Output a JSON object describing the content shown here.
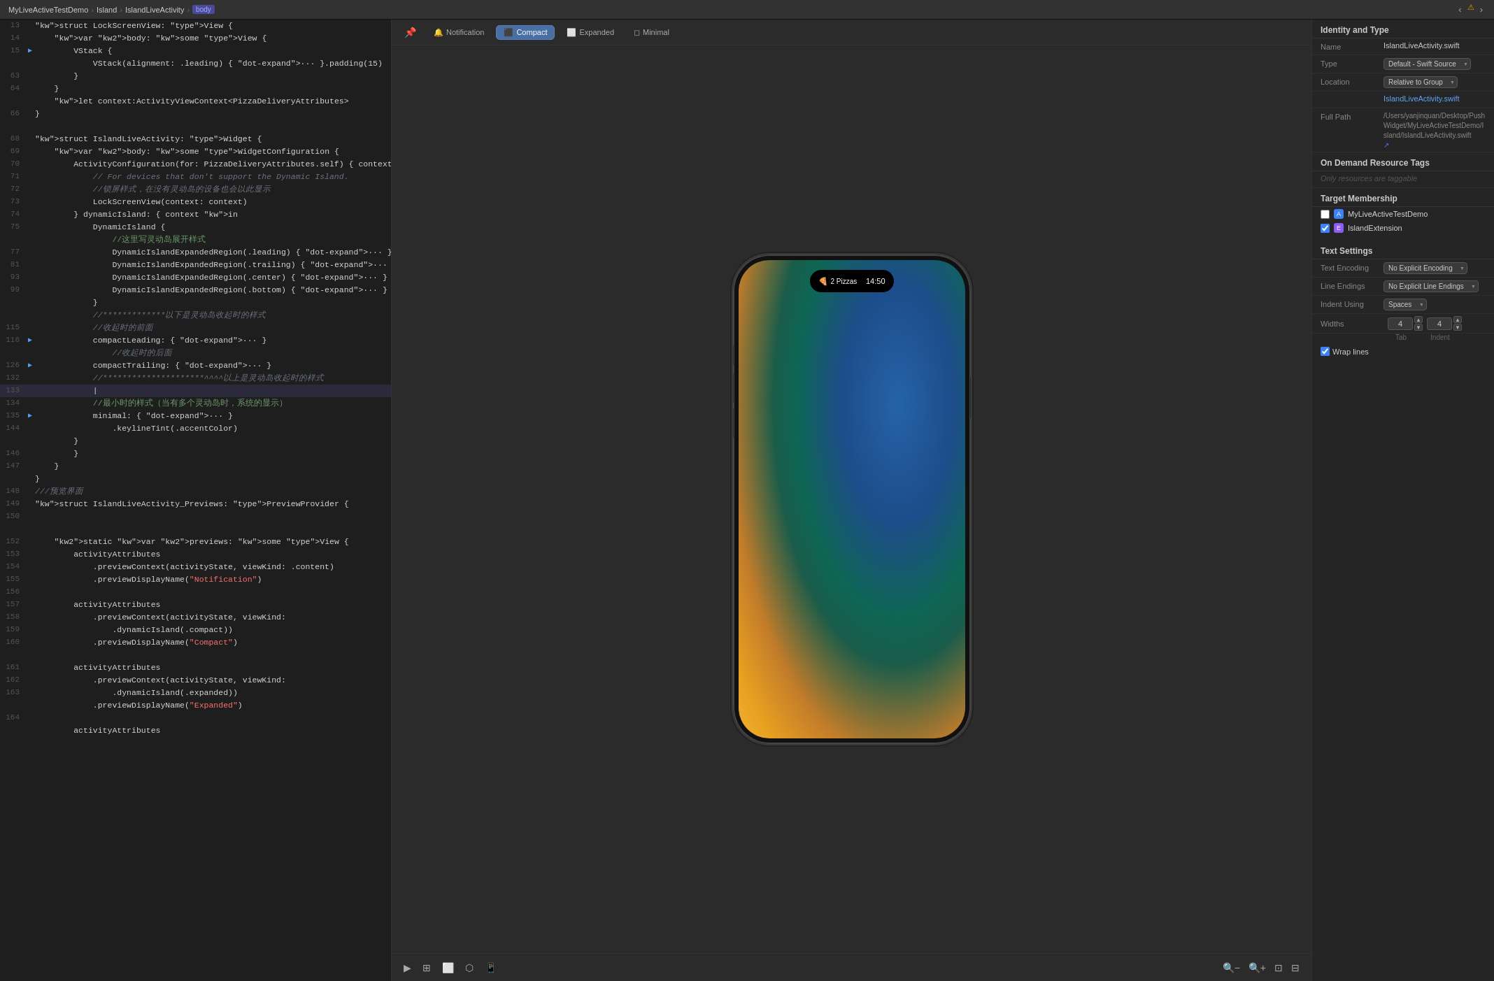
{
  "titlebar": {
    "app": "MyLiveActiveTestDemo",
    "sep1": "›",
    "folder": "Island",
    "sep2": "›",
    "file": "IslandLiveActivity",
    "sep3": "›",
    "body_label": "body",
    "nav_back": "‹",
    "nav_forward": "›",
    "warning": "⚠"
  },
  "preview_toolbar": {
    "pin_icon": "📌",
    "notification_label": "Notification",
    "compact_label": "Compact",
    "expanded_label": "Expanded",
    "minimal_label": "Minimal",
    "active_tab": "Compact"
  },
  "preview_bottom": {
    "play_icon": "▶",
    "grid_icon": "⊞",
    "qr_icon": "⬜",
    "more_icon": "⋯",
    "device_icon": "📱",
    "clock_icon": "⏱",
    "zoom_out_icon": "−",
    "zoom_in_icon": "+",
    "zoom_fit_icon": "⊡",
    "zoom_fill_icon": "⊟"
  },
  "phone": {
    "pizza_icon": "🍕",
    "pizza_label": "2 Pizzas",
    "time": "14:50"
  },
  "inspector": {
    "title": "Identity and Type",
    "name_label": "Name",
    "name_value": "IslandLiveActivity.swift",
    "type_label": "Type",
    "type_value": "Default - Swift Source",
    "location_label": "Location",
    "location_value": "Relative to Group",
    "filename_value": "IslandLiveActivity.swift",
    "full_path_label": "Full Path",
    "full_path_value": "/Users/yanjinquan/Desktop/PushWidget/MyLiveActiveTestDemo/Island/IslandLiveActivity.swift",
    "full_path_icon": "↗",
    "on_demand_label": "On Demand Resource Tags",
    "on_demand_hint": "Only resources are taggable",
    "target_membership_label": "Target Membership",
    "target1": "MyLiveActiveTestDemo",
    "target2": "IslandExtension",
    "text_settings_label": "Text Settings",
    "text_encoding_label": "Text Encoding",
    "text_encoding_value": "No Explicit Encoding",
    "line_endings_label": "Line Endings",
    "line_endings_value": "No Explicit Line Endings",
    "indent_using_label": "Indent Using",
    "indent_using_value": "Spaces",
    "widths_label": "Widths",
    "tab_value": "4",
    "indent_value": "4",
    "tab_sublabel": "Tab",
    "indent_sublabel": "Indent",
    "wrap_lines_label": "Wrap lines"
  },
  "code_lines": [
    {
      "num": "13",
      "indicator": "",
      "content": "struct LockScreenView: View {",
      "active": false
    },
    {
      "num": "14",
      "indicator": "",
      "content": "    var body: some View {",
      "active": false
    },
    {
      "num": "15",
      "indicator": "▶",
      "content": "        VStack {",
      "active": false
    },
    {
      "num": "",
      "indicator": "",
      "content": "            VStack(alignment: .leading) { ··· }.padding(15)",
      "active": false
    },
    {
      "num": "63",
      "indicator": "",
      "content": "        }",
      "active": false
    },
    {
      "num": "64",
      "indicator": "",
      "content": "    }",
      "active": false
    },
    {
      "num": "",
      "indicator": "",
      "content": "    let context:ActivityViewContext<PizzaDeliveryAttributes>",
      "active": false
    },
    {
      "num": "66",
      "indicator": "",
      "content": "}",
      "active": false
    },
    {
      "num": "",
      "indicator": "",
      "content": "",
      "active": false
    },
    {
      "num": "68",
      "indicator": "",
      "content": "struct IslandLiveActivity: Widget {",
      "active": false
    },
    {
      "num": "69",
      "indicator": "",
      "content": "    var body: some WidgetConfiguration {",
      "active": false
    },
    {
      "num": "70",
      "indicator": "",
      "content": "        ActivityConfiguration(for: PizzaDeliveryAttributes.self) { context in",
      "active": false
    },
    {
      "num": "71",
      "indicator": "",
      "content": "            // For devices that don't support the Dynamic Island.",
      "active": false,
      "comment": true
    },
    {
      "num": "72",
      "indicator": "",
      "content": "            //锁屏样式，在没有灵动岛的设备也会以此显示",
      "active": false,
      "comment": true
    },
    {
      "num": "73",
      "indicator": "",
      "content": "            LockScreenView(context: context)",
      "active": false
    },
    {
      "num": "74",
      "indicator": "",
      "content": "        } dynamicIsland: { context in",
      "active": false
    },
    {
      "num": "75",
      "indicator": "",
      "content": "            DynamicIsland {",
      "active": false
    },
    {
      "num": "",
      "indicator": "",
      "content": "                //这里写灵动岛展开样式",
      "active": false,
      "comment_cn": true
    },
    {
      "num": "77",
      "indicator": "",
      "content": "                DynamicIslandExpandedRegion(.leading) { ··· }",
      "active": false
    },
    {
      "num": "81",
      "indicator": "",
      "content": "                DynamicIslandExpandedRegion(.trailing) { ··· }",
      "active": false
    },
    {
      "num": "93",
      "indicator": "",
      "content": "                DynamicIslandExpandedRegion(.center) { ··· }",
      "active": false
    },
    {
      "num": "99",
      "indicator": "",
      "content": "                DynamicIslandExpandedRegion(.bottom) { ··· }",
      "active": false
    },
    {
      "num": "",
      "indicator": "",
      "content": "            }",
      "active": false
    },
    {
      "num": "",
      "indicator": "",
      "content": "            //*************以下是灵动岛收起时的样式",
      "active": false,
      "comment": true
    },
    {
      "num": "115",
      "indicator": "",
      "content": "            //收起时的前面",
      "active": false,
      "comment": true
    },
    {
      "num": "116",
      "indicator": "▶",
      "content": "            compactLeading: { ··· }",
      "active": false
    },
    {
      "num": "",
      "indicator": "",
      "content": "                //收起时的后面",
      "active": false,
      "comment": true
    },
    {
      "num": "126",
      "indicator": "▶",
      "content": "            compactTrailing: { ··· }",
      "active": false
    },
    {
      "num": "132",
      "indicator": "",
      "content": "            //*********************^^^^以上是灵动岛收起时的样式",
      "active": false,
      "comment": true
    },
    {
      "num": "133",
      "indicator": "",
      "content": "            |",
      "active": true
    },
    {
      "num": "134",
      "indicator": "",
      "content": "            //最小时的样式（当有多个灵动岛时，系统的显示）",
      "active": false,
      "comment_cn": true
    },
    {
      "num": "135",
      "indicator": "▶",
      "content": "            minimal: { ··· }",
      "active": false
    },
    {
      "num": "144",
      "indicator": "",
      "content": "                .keylineTint(.accentColor)",
      "active": false
    },
    {
      "num": "",
      "indicator": "",
      "content": "        }",
      "active": false
    },
    {
      "num": "146",
      "indicator": "",
      "content": "        }",
      "active": false
    },
    {
      "num": "147",
      "indicator": "",
      "content": "    }",
      "active": false
    },
    {
      "num": "",
      "indicator": "",
      "content": "}",
      "active": false
    },
    {
      "num": "148",
      "indicator": "",
      "content": "///预览界面",
      "active": false,
      "comment": true
    },
    {
      "num": "149",
      "indicator": "",
      "content": "struct IslandLiveActivity_Previews: PreviewProvider {",
      "active": false
    },
    {
      "num": "150",
      "indicator": "",
      "content": "",
      "active": false
    },
    {
      "num": "",
      "indicator": "",
      "content": "",
      "active": false
    },
    {
      "num": "152",
      "indicator": "",
      "content": "    static var previews: some View {",
      "active": false
    },
    {
      "num": "153",
      "indicator": "",
      "content": "        activityAttributes",
      "active": false
    },
    {
      "num": "154",
      "indicator": "",
      "content": "            .previewContext(activityState, viewKind: .content)",
      "active": false
    },
    {
      "num": "155",
      "indicator": "",
      "content": "            .previewDisplayName(\"Notification\")",
      "active": false
    },
    {
      "num": "156",
      "indicator": "",
      "content": "",
      "active": false
    },
    {
      "num": "157",
      "indicator": "",
      "content": "        activityAttributes",
      "active": false
    },
    {
      "num": "158",
      "indicator": "",
      "content": "            .previewContext(activityState, viewKind:",
      "active": false
    },
    {
      "num": "159",
      "indicator": "",
      "content": "                .dynamicIsland(.compact))",
      "active": false
    },
    {
      "num": "160",
      "indicator": "",
      "content": "            .previewDisplayName(\"Compact\")",
      "active": false
    },
    {
      "num": "",
      "indicator": "",
      "content": "",
      "active": false
    },
    {
      "num": "161",
      "indicator": "",
      "content": "        activityAttributes",
      "active": false
    },
    {
      "num": "162",
      "indicator": "",
      "content": "            .previewContext(activityState, viewKind:",
      "active": false
    },
    {
      "num": "163",
      "indicator": "",
      "content": "                .dynamicIsland(.expanded))",
      "active": false
    },
    {
      "num": "",
      "indicator": "",
      "content": "            .previewDisplayName(\"Expanded\")",
      "active": false
    },
    {
      "num": "164",
      "indicator": "",
      "content": "",
      "active": false
    },
    {
      "num": "",
      "indicator": "",
      "content": "        activityAttributes",
      "active": false
    }
  ]
}
